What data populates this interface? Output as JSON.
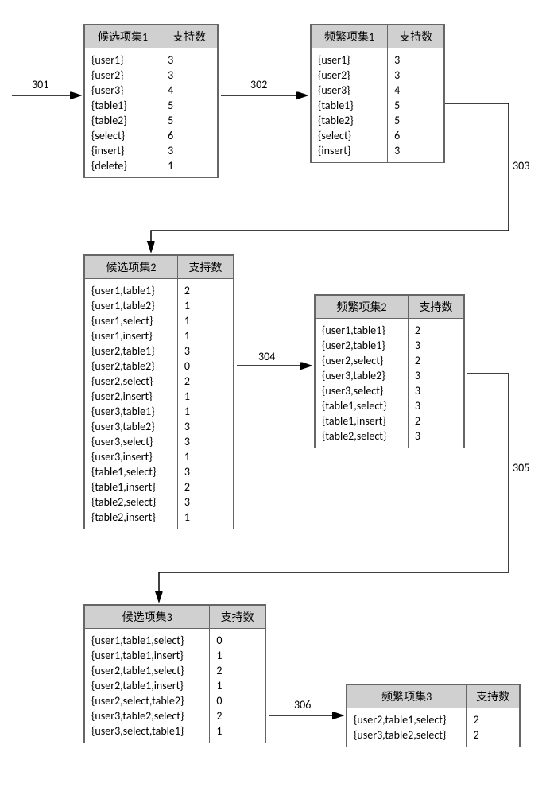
{
  "headers": {
    "support": "支持数",
    "cand1": "候选项集1",
    "freq1": "频繁项集1",
    "cand2": "候选项集2",
    "freq2": "频繁项集2",
    "cand3": "候选项集3",
    "freq3": "频繁项集3"
  },
  "labels": {
    "301": "301",
    "302": "302",
    "303": "303",
    "304": "304",
    "305": "305",
    "306": "306"
  },
  "cand1": {
    "rows": [
      {
        "item": "{user1}",
        "sup": "3"
      },
      {
        "item": "{user2}",
        "sup": "3"
      },
      {
        "item": "{user3}",
        "sup": "4"
      },
      {
        "item": "{table1}",
        "sup": "5"
      },
      {
        "item": "{table2}",
        "sup": "5"
      },
      {
        "item": "{select}",
        "sup": "6"
      },
      {
        "item": "{insert}",
        "sup": "3"
      },
      {
        "item": "{delete}",
        "sup": "1"
      }
    ]
  },
  "freq1": {
    "rows": [
      {
        "item": "{user1}",
        "sup": "3"
      },
      {
        "item": "{user2}",
        "sup": "3"
      },
      {
        "item": "{user3}",
        "sup": "4"
      },
      {
        "item": "{table1}",
        "sup": "5"
      },
      {
        "item": "{table2}",
        "sup": "5"
      },
      {
        "item": "{select}",
        "sup": "6"
      },
      {
        "item": "{insert}",
        "sup": "3"
      }
    ]
  },
  "cand2": {
    "rows": [
      {
        "item": "{user1,table1}",
        "sup": "2"
      },
      {
        "item": "{user1,table2}",
        "sup": "1"
      },
      {
        "item": "{user1,select}",
        "sup": "1"
      },
      {
        "item": "{user1,insert}",
        "sup": "1"
      },
      {
        "item": "{user2,table1}",
        "sup": "3"
      },
      {
        "item": "{user2,table2}",
        "sup": "0"
      },
      {
        "item": "{user2,select}",
        "sup": "2"
      },
      {
        "item": "{user2,insert}",
        "sup": "1"
      },
      {
        "item": "{user3,table1}",
        "sup": "1"
      },
      {
        "item": "{user3,table2}",
        "sup": "3"
      },
      {
        "item": "{user3,select}",
        "sup": "3"
      },
      {
        "item": "{user3,insert}",
        "sup": "1"
      },
      {
        "item": "{table1,select}",
        "sup": "3"
      },
      {
        "item": "{table1,insert}",
        "sup": "2"
      },
      {
        "item": "{table2,select}",
        "sup": "3"
      },
      {
        "item": "{table2,insert}",
        "sup": "1"
      }
    ]
  },
  "freq2": {
    "rows": [
      {
        "item": "{user1,table1}",
        "sup": "2"
      },
      {
        "item": "{user2,table1}",
        "sup": "3"
      },
      {
        "item": "{user2,select}",
        "sup": "2"
      },
      {
        "item": "{user3,table2}",
        "sup": "3"
      },
      {
        "item": "{user3,select}",
        "sup": "3"
      },
      {
        "item": "{table1,select}",
        "sup": "3"
      },
      {
        "item": "{table1,insert}",
        "sup": "2"
      },
      {
        "item": "{table2,select}",
        "sup": "3"
      }
    ]
  },
  "cand3": {
    "rows": [
      {
        "item": "{user1,table1,select}",
        "sup": "0"
      },
      {
        "item": "{user1,table1,insert}",
        "sup": "1"
      },
      {
        "item": "{user2,table1,select}",
        "sup": "2"
      },
      {
        "item": "{user2,table1,insert}",
        "sup": "1"
      },
      {
        "item": "{user2,select,table2}",
        "sup": "0"
      },
      {
        "item": "{user3,table2,select}",
        "sup": "2"
      },
      {
        "item": "{user3,select,table1}",
        "sup": "1"
      }
    ]
  },
  "freq3": {
    "rows": [
      {
        "item": "{user2,table1,select}",
        "sup": "2"
      },
      {
        "item": "{user3,table2,select}",
        "sup": "2"
      }
    ]
  }
}
